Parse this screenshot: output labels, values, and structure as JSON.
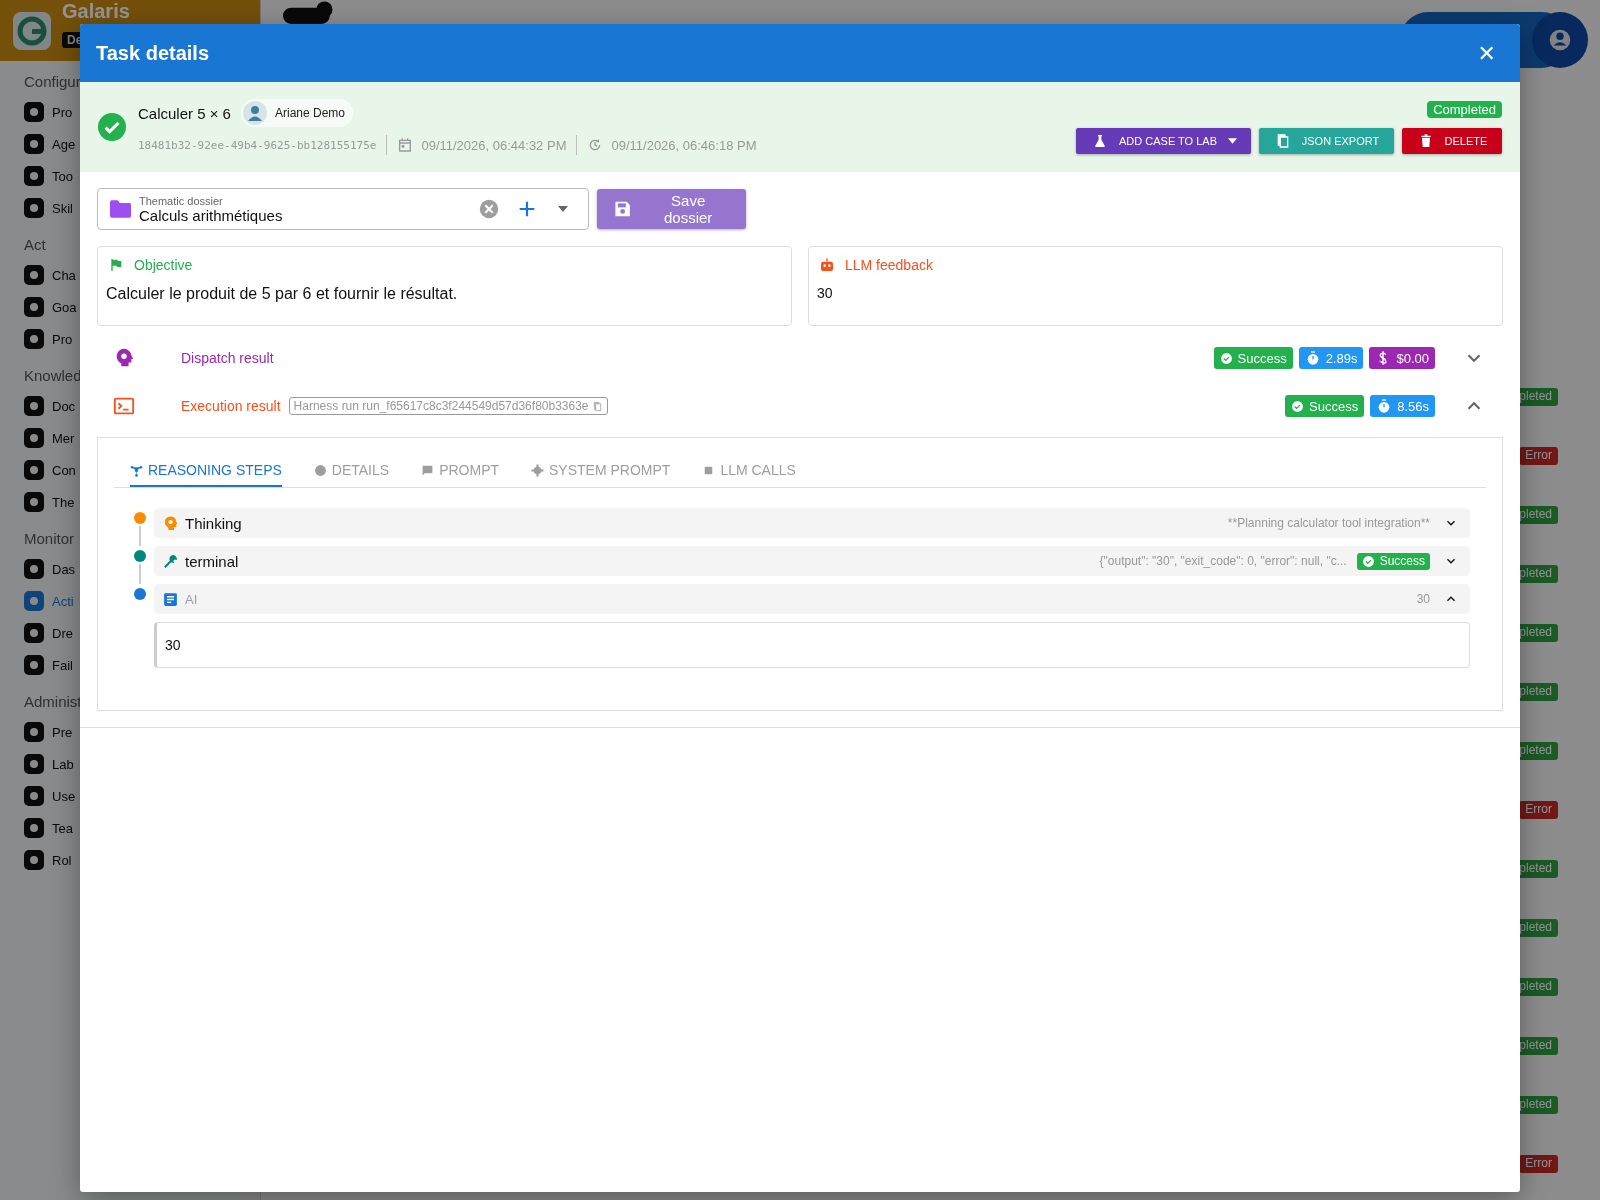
{
  "app": {
    "brand": "Galaris",
    "env_badge": "De",
    "sidebar": [
      {
        "heading": "Configur",
        "items": [
          {
            "label": "Pro",
            "selected": false
          },
          {
            "label": "Age",
            "selected": false
          },
          {
            "label": "Too",
            "selected": false
          },
          {
            "label": "Skil",
            "selected": false
          }
        ]
      },
      {
        "heading": "Act",
        "items": [
          {
            "label": "Cha",
            "selected": false
          },
          {
            "label": "Goa",
            "selected": false
          },
          {
            "label": "Pro",
            "selected": false
          }
        ]
      },
      {
        "heading": "Knowled",
        "items": [
          {
            "label": "Doc",
            "selected": false
          },
          {
            "label": "Mer",
            "selected": false
          },
          {
            "label": "Con",
            "selected": false
          },
          {
            "label": "The",
            "selected": false
          }
        ]
      },
      {
        "heading": "Monitor",
        "items": [
          {
            "label": "Das",
            "selected": false
          },
          {
            "label": "Acti",
            "selected": true
          },
          {
            "label": "Dre",
            "selected": false
          },
          {
            "label": "Fail",
            "selected": false
          }
        ]
      },
      {
        "heading": "Administ",
        "items": [
          {
            "label": "Pre",
            "selected": false
          },
          {
            "label": "Lab",
            "selected": false
          },
          {
            "label": "Use",
            "selected": false
          },
          {
            "label": "Tea",
            "selected": false
          },
          {
            "label": "Rol",
            "selected": false
          }
        ]
      }
    ],
    "status_chips": [
      {
        "label": "pleted",
        "kind": "completed"
      },
      {
        "label": "Error",
        "kind": "error"
      },
      {
        "label": "pleted",
        "kind": "completed"
      },
      {
        "label": "pleted",
        "kind": "completed"
      },
      {
        "label": "pleted",
        "kind": "completed"
      },
      {
        "label": "pleted",
        "kind": "completed"
      },
      {
        "label": "pleted",
        "kind": "completed"
      },
      {
        "label": "Error",
        "kind": "error"
      },
      {
        "label": "pleted",
        "kind": "completed"
      },
      {
        "label": "pleted",
        "kind": "completed"
      },
      {
        "label": "pleted",
        "kind": "completed"
      },
      {
        "label": "pleted",
        "kind": "completed"
      },
      {
        "label": "pleted",
        "kind": "completed"
      },
      {
        "label": "Error",
        "kind": "error"
      }
    ]
  },
  "dialog": {
    "title": "Task details",
    "close": "✕",
    "task": {
      "name": "Calculer 5 × 6",
      "user": "Ariane Demo",
      "id": "18481b32-92ee-49b4-9625-bb128155175e",
      "created": "09/11/2026, 06:44:32 PM",
      "finished": "09/11/2026, 06:46:18 PM",
      "status": "Completed"
    },
    "actions": [
      {
        "label": "ADD CASE TO LAB",
        "kind": "lab"
      },
      {
        "label": "JSON EXPORT",
        "kind": "export"
      },
      {
        "label": "DELETE",
        "kind": "delete"
      }
    ],
    "dossier": {
      "label": "Thematic dossier",
      "value": "Calculs arithmétiques",
      "save": "Save dossier"
    },
    "objective": {
      "title": "Objective",
      "text": "Calculer le produit de 5 par 6 et fournir le résultat."
    },
    "feedback": {
      "title": "LLM feedback",
      "text": "30"
    },
    "results": [
      {
        "kind": "dispatch",
        "title": "Dispatch result",
        "expanded": false,
        "badges": [
          {
            "kind": "success",
            "label": "Success"
          },
          {
            "kind": "time",
            "label": "2.89s"
          },
          {
            "kind": "cost",
            "label": "$0.00"
          }
        ]
      },
      {
        "kind": "execution",
        "title": "Execution result",
        "run": "Harness run run_f65617c8c3f244549d57d36f80b3363e",
        "expanded": true,
        "badges": [
          {
            "kind": "success",
            "label": "Success"
          },
          {
            "kind": "time",
            "label": "8.56s"
          }
        ]
      }
    ],
    "tabs": [
      {
        "label": "REASONING STEPS",
        "selected": true
      },
      {
        "label": "DETAILS",
        "selected": false
      },
      {
        "label": "PROMPT",
        "selected": false
      },
      {
        "label": "SYSTEM PROMPT",
        "selected": false
      },
      {
        "label": "LLM CALLS",
        "selected": false
      }
    ],
    "steps": [
      {
        "kind": "thinking",
        "color": "#fb8c00",
        "title": "Thinking",
        "summary": "**Planning calculator tool integration**",
        "expanded": false
      },
      {
        "kind": "tool",
        "color": "#00897b",
        "title": "terminal",
        "summary": "{\"output\": \"30\", \"exit_code\": 0, \"error\": null, \"c...",
        "badge": "Success",
        "expanded": false
      },
      {
        "kind": "ai",
        "color": "#1976d2",
        "title": "AI",
        "summary": "30",
        "expanded": true,
        "content": "30"
      }
    ]
  }
}
